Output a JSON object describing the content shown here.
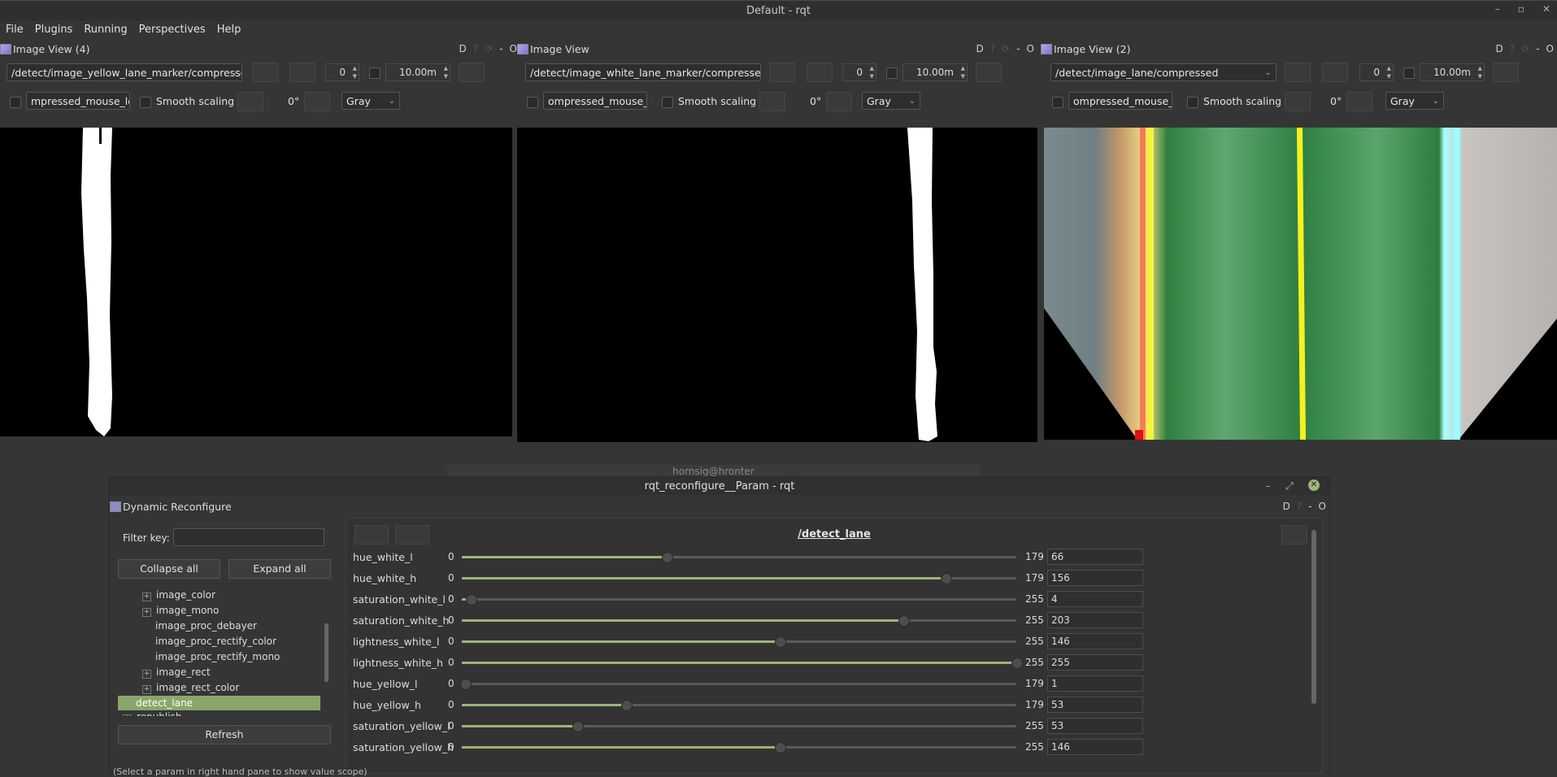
{
  "window": {
    "title": "Default - rqt"
  },
  "menu": [
    "File",
    "Plugins",
    "Running",
    "Perspectives",
    "Help"
  ],
  "panels": [
    {
      "title": "Image View (4)",
      "topic": "/detect/image_yellow_lane_marker/compressed",
      "spin": "0",
      "time": "10.00m",
      "mouse_topic": "mpressed_mouse_left",
      "smooth": "Smooth scaling",
      "rotation": "0°",
      "colormap": "Gray"
    },
    {
      "title": "Image View",
      "topic": "/detect/image_white_lane_marker/compressed",
      "spin": "0",
      "time": "10.00m",
      "mouse_topic": "ompressed_mouse_left",
      "smooth": "Smooth scaling",
      "rotation": "0°",
      "colormap": "Gray"
    },
    {
      "title": "Image View (2)",
      "topic": "/detect/image_lane/compressed",
      "spin": "0",
      "time": "10.00m",
      "mouse_topic": "ompressed_mouse_left",
      "smooth": "Smooth scaling",
      "rotation": "0°",
      "colormap": "Gray"
    }
  ],
  "panel_ctrls": {
    "d": "D",
    "min": "-",
    "o": "O"
  },
  "behind_window_title": "hornsig@hronter",
  "dialog": {
    "title": "rqt_reconfigure__Param - rqt",
    "plugin_title": "Dynamic Reconfigure",
    "filter_label": "Filter key:",
    "collapse_all": "Collapse all",
    "expand_all": "Expand all",
    "tree": [
      {
        "label": "image_color",
        "expand": "+"
      },
      {
        "label": "image_mono",
        "expand": "+"
      },
      {
        "label": "image_proc_debayer",
        "expand": ""
      },
      {
        "label": "image_proc_rectify_color",
        "expand": ""
      },
      {
        "label": "image_proc_rectify_mono",
        "expand": ""
      },
      {
        "label": "image_rect",
        "expand": "+"
      },
      {
        "label": "image_rect_color",
        "expand": "+"
      },
      {
        "label": "detect_lane",
        "expand": ""
      },
      {
        "label": "republish",
        "expand": "+"
      }
    ],
    "refresh": "Refresh",
    "node_title": "/detect_lane",
    "params": [
      {
        "name": "hue_white_l",
        "min": "0",
        "max": "179",
        "value": "66",
        "fraction": 0.369
      },
      {
        "name": "hue_white_h",
        "min": "0",
        "max": "179",
        "value": "156",
        "fraction": 0.872
      },
      {
        "name": "saturation_white_l",
        "min": "0",
        "max": "255",
        "value": "4",
        "fraction": 0.016
      },
      {
        "name": "saturation_white_h",
        "min": "0",
        "max": "255",
        "value": "203",
        "fraction": 0.796
      },
      {
        "name": "lightness_white_l",
        "min": "0",
        "max": "255",
        "value": "146",
        "fraction": 0.573
      },
      {
        "name": "lightness_white_h",
        "min": "0",
        "max": "255",
        "value": "255",
        "fraction": 1.0
      },
      {
        "name": "hue_yellow_l",
        "min": "0",
        "max": "179",
        "value": "1",
        "fraction": 0.006
      },
      {
        "name": "hue_yellow_h",
        "min": "0",
        "max": "179",
        "value": "53",
        "fraction": 0.296
      },
      {
        "name": "saturation_yellow_l",
        "min": "0",
        "max": "255",
        "value": "53",
        "fraction": 0.208
      },
      {
        "name": "saturation_yellow_h",
        "min": "0",
        "max": "255",
        "value": "146",
        "fraction": 0.573
      }
    ],
    "status_text": "(Select a param in right hand pane to show value scope)"
  }
}
